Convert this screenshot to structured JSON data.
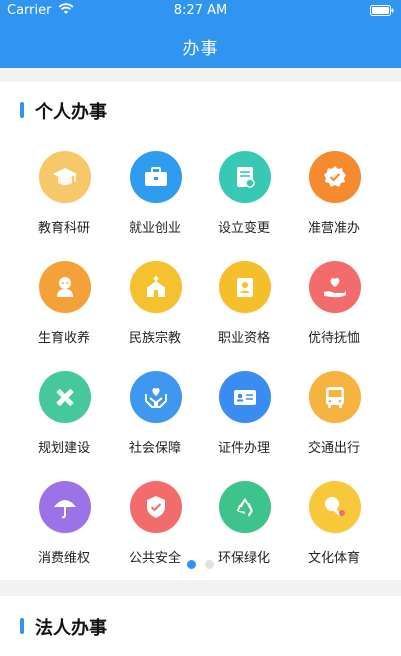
{
  "status_bar": {
    "carrier": "Carrier",
    "time": "8:27 AM"
  },
  "header": {
    "title": "办事"
  },
  "sections": [
    {
      "title": "个人办事",
      "items": [
        {
          "label": "教育科研",
          "icon": "graduation-cap-icon",
          "color": "#f6c86a"
        },
        {
          "label": "就业创业",
          "icon": "briefcase-icon",
          "color": "#2f9cf0"
        },
        {
          "label": "设立变更",
          "icon": "document-edit-icon",
          "color": "#37c9b4"
        },
        {
          "label": "准营准办",
          "icon": "badge-check-icon",
          "color": "#f58a2e"
        },
        {
          "label": "生育收养",
          "icon": "baby-icon",
          "color": "#f5a13a"
        },
        {
          "label": "民族宗教",
          "icon": "temple-icon",
          "color": "#f4c22e"
        },
        {
          "label": "职业资格",
          "icon": "id-badge-icon",
          "color": "#f4bf2a"
        },
        {
          "label": "优待抚恤",
          "icon": "heart-hand-icon",
          "color": "#f36c6c"
        },
        {
          "label": "规划建设",
          "icon": "ruler-pencil-icon",
          "color": "#45c89b"
        },
        {
          "label": "社会保障",
          "icon": "hands-heart-icon",
          "color": "#3f98ef"
        },
        {
          "label": "证件办理",
          "icon": "id-card-icon",
          "color": "#3b8cf0"
        },
        {
          "label": "交通出行",
          "icon": "bus-icon",
          "color": "#f7b33f"
        },
        {
          "label": "消费维权",
          "icon": "umbrella-icon",
          "color": "#9b73e6"
        },
        {
          "label": "公共安全",
          "icon": "shield-check-icon",
          "color": "#f36c6c"
        },
        {
          "label": "环保绿化",
          "icon": "recycle-icon",
          "color": "#3ec38d"
        },
        {
          "label": "文化体育",
          "icon": "ping-pong-icon",
          "color": "#f7c83a"
        }
      ]
    },
    {
      "title": "法人办事"
    }
  ],
  "pager": {
    "active_color": "#2f95f1",
    "inactive_color": "#e1e1e1",
    "pages": 2,
    "active_index": 0
  }
}
